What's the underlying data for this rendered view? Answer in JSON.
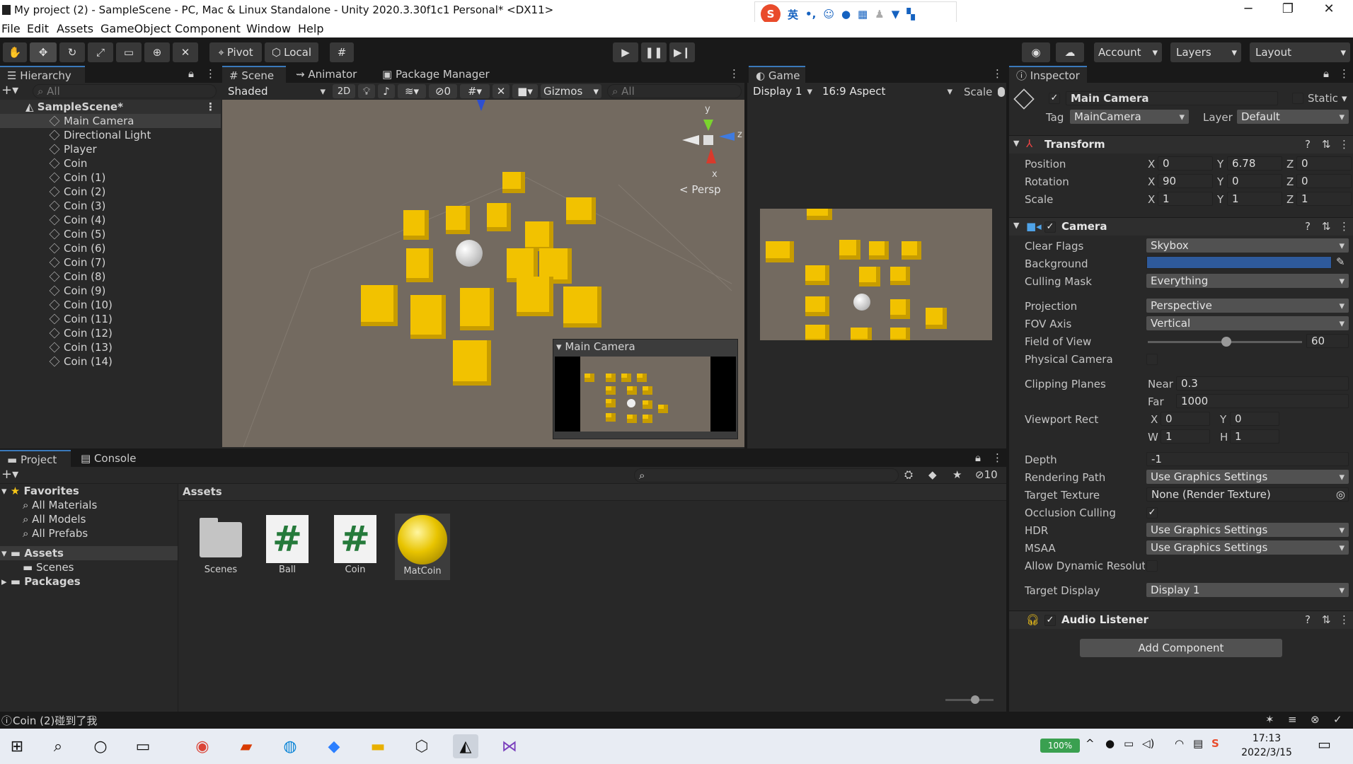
{
  "window": {
    "title": "My project (2) - SampleScene - PC, Mac & Linux Standalone - Unity 2020.3.30f1c1 Personal* <DX11>",
    "minimize": "─",
    "restore": "❐",
    "close": "✕"
  },
  "menu": [
    "File",
    "Edit",
    "Assets",
    "GameObject",
    "Component",
    "Window",
    "Help"
  ],
  "ime": {
    "logo": "S",
    "lang": "英",
    "punct": "•,"
  },
  "toolbar": {
    "pivot": "Pivot",
    "local": "Local",
    "account": "Account",
    "layers": "Layers",
    "layout": "Layout"
  },
  "hierarchy": {
    "tab": "Hierarchy",
    "search": "All",
    "scene": "SampleScene*",
    "items": [
      "Main Camera",
      "Directional Light",
      "Player",
      "Coin",
      "Coin (1)",
      "Coin (2)",
      "Coin (3)",
      "Coin (4)",
      "Coin (5)",
      "Coin (6)",
      "Coin (7)",
      "Coin (8)",
      "Coin (9)",
      "Coin (10)",
      "Coin (11)",
      "Coin (12)",
      "Coin (13)",
      "Coin (14)"
    ]
  },
  "scene": {
    "tabs": [
      "Scene",
      "Animator",
      "Package Manager"
    ],
    "shading": "Shaded",
    "mode2d": "2D",
    "hidden_count": "0",
    "gizmos": "Gizmos",
    "search": "All",
    "persp": "< Persp",
    "axes": {
      "x": "x",
      "y": "y",
      "z": "z"
    },
    "camera_preview": "Main Camera"
  },
  "game": {
    "tab": "Game",
    "display": "Display 1",
    "aspect": "16:9 Aspect",
    "scale": "Scale"
  },
  "project": {
    "tabs": [
      "Project",
      "Console"
    ],
    "favorites": "Favorites",
    "fav_items": [
      "All Materials",
      "All Models",
      "All Prefabs"
    ],
    "assets": "Assets",
    "asset_children": [
      "Scenes"
    ],
    "packages": "Packages",
    "breadcrumb": "Assets",
    "hidden_count": "10",
    "files": [
      {
        "name": "Scenes",
        "kind": "folder"
      },
      {
        "name": "Ball",
        "kind": "script"
      },
      {
        "name": "Coin",
        "kind": "script"
      },
      {
        "name": "MatCoin",
        "kind": "material"
      }
    ]
  },
  "status": {
    "message": "Coin (2)碰到了我"
  },
  "inspector": {
    "tab": "Inspector",
    "object_name": "Main Camera",
    "static": "Static",
    "tag_label": "Tag",
    "tag": "MainCamera",
    "layer_label": "Layer",
    "layer": "Default",
    "transform": {
      "title": "Transform",
      "position_label": "Position",
      "rotation_label": "Rotation",
      "scale_label": "Scale",
      "position": [
        "0",
        "6.78",
        "0"
      ],
      "rotation": [
        "90",
        "0",
        "0"
      ],
      "scale": [
        "1",
        "1",
        "1"
      ]
    },
    "camera": {
      "title": "Camera",
      "fields": {
        "clear_flags": [
          "Clear Flags",
          "Skybox"
        ],
        "background": [
          "Background",
          ""
        ],
        "culling_mask": [
          "Culling Mask",
          "Everything"
        ],
        "projection": [
          "Projection",
          "Perspective"
        ],
        "fov_axis": [
          "FOV Axis",
          "Vertical"
        ],
        "field_of_view": [
          "Field of View",
          "60"
        ],
        "physical_camera": [
          "Physical Camera",
          ""
        ],
        "clipping_planes": [
          "Clipping Planes",
          ""
        ],
        "near": [
          "Near",
          "0.3"
        ],
        "far": [
          "Far",
          "1000"
        ],
        "viewport_rect": [
          "Viewport Rect",
          ""
        ],
        "vx": [
          "X",
          "0"
        ],
        "vy": [
          "Y",
          "0"
        ],
        "vw": [
          "W",
          "1"
        ],
        "vh": [
          "H",
          "1"
        ],
        "depth": [
          "Depth",
          "-1"
        ],
        "rendering_path": [
          "Rendering Path",
          "Use Graphics Settings"
        ],
        "target_texture": [
          "Target Texture",
          "None (Render Texture)"
        ],
        "occlusion_culling": [
          "Occlusion Culling",
          ""
        ],
        "hdr": [
          "HDR",
          "Use Graphics Settings"
        ],
        "msaa": [
          "MSAA",
          "Use Graphics Settings"
        ],
        "allow_dynamic": [
          "Allow Dynamic Resoluti",
          ""
        ],
        "target_display": [
          "Target Display",
          "Display 1"
        ]
      },
      "fov_fraction": 0.51,
      "background_color": "#2e5a9c"
    },
    "audio_listener": "Audio Listener",
    "add_component": "Add Component"
  },
  "taskbar": {
    "battery": "100%",
    "time": "17:13",
    "date": "2022/3/15"
  },
  "colors": {
    "accent": "#3a79bb",
    "coin": "#f2c200",
    "scene_bg": "#736a60"
  }
}
